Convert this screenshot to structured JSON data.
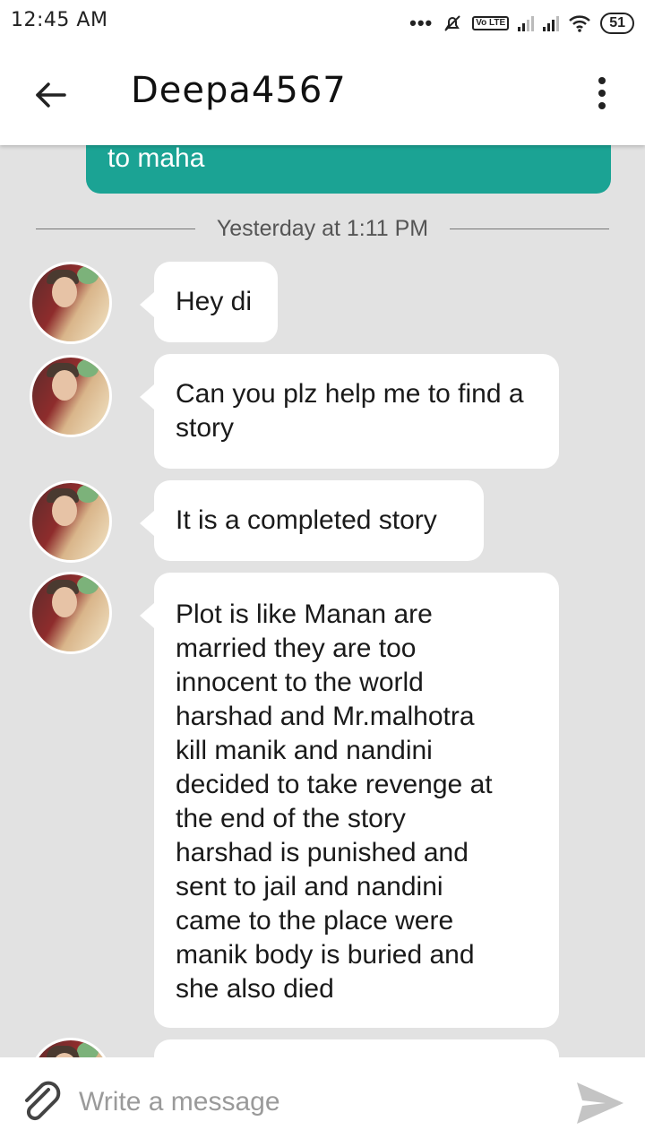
{
  "status_bar": {
    "time": "12:45 AM",
    "battery": "51",
    "volte": "Vo LTE",
    "icons": [
      "more-dots-icon",
      "notifications-off-icon",
      "volte-icon",
      "signal-icon",
      "signal-icon",
      "wifi-icon",
      "battery-icon"
    ]
  },
  "header": {
    "title": "Deepa4567",
    "back_icon": "arrow-left-icon",
    "more_icon": "more-vertical-icon"
  },
  "previous_message": {
    "text": "to maha"
  },
  "divider": {
    "label": "Yesterday at 1:11 PM"
  },
  "messages": [
    {
      "text": "Hey di"
    },
    {
      "text": "Can you plz help me to find a story"
    },
    {
      "text": "It is a completed story"
    },
    {
      "text": "Plot is like Manan are married they are too innocent to the world harshad and Mr.malhotra kill manik and nandini decided to take revenge at the end of the story harshad is punished and sent to jail and nandini came to the place were manik body is buried and she also died"
    }
  ],
  "composer": {
    "placeholder": "Write a message",
    "attach_icon": "paperclip-icon",
    "send_icon": "send-icon"
  },
  "colors": {
    "sent_bubble": "#1ba394",
    "chat_background": "#e2e2e2",
    "received_bubble": "#ffffff"
  }
}
